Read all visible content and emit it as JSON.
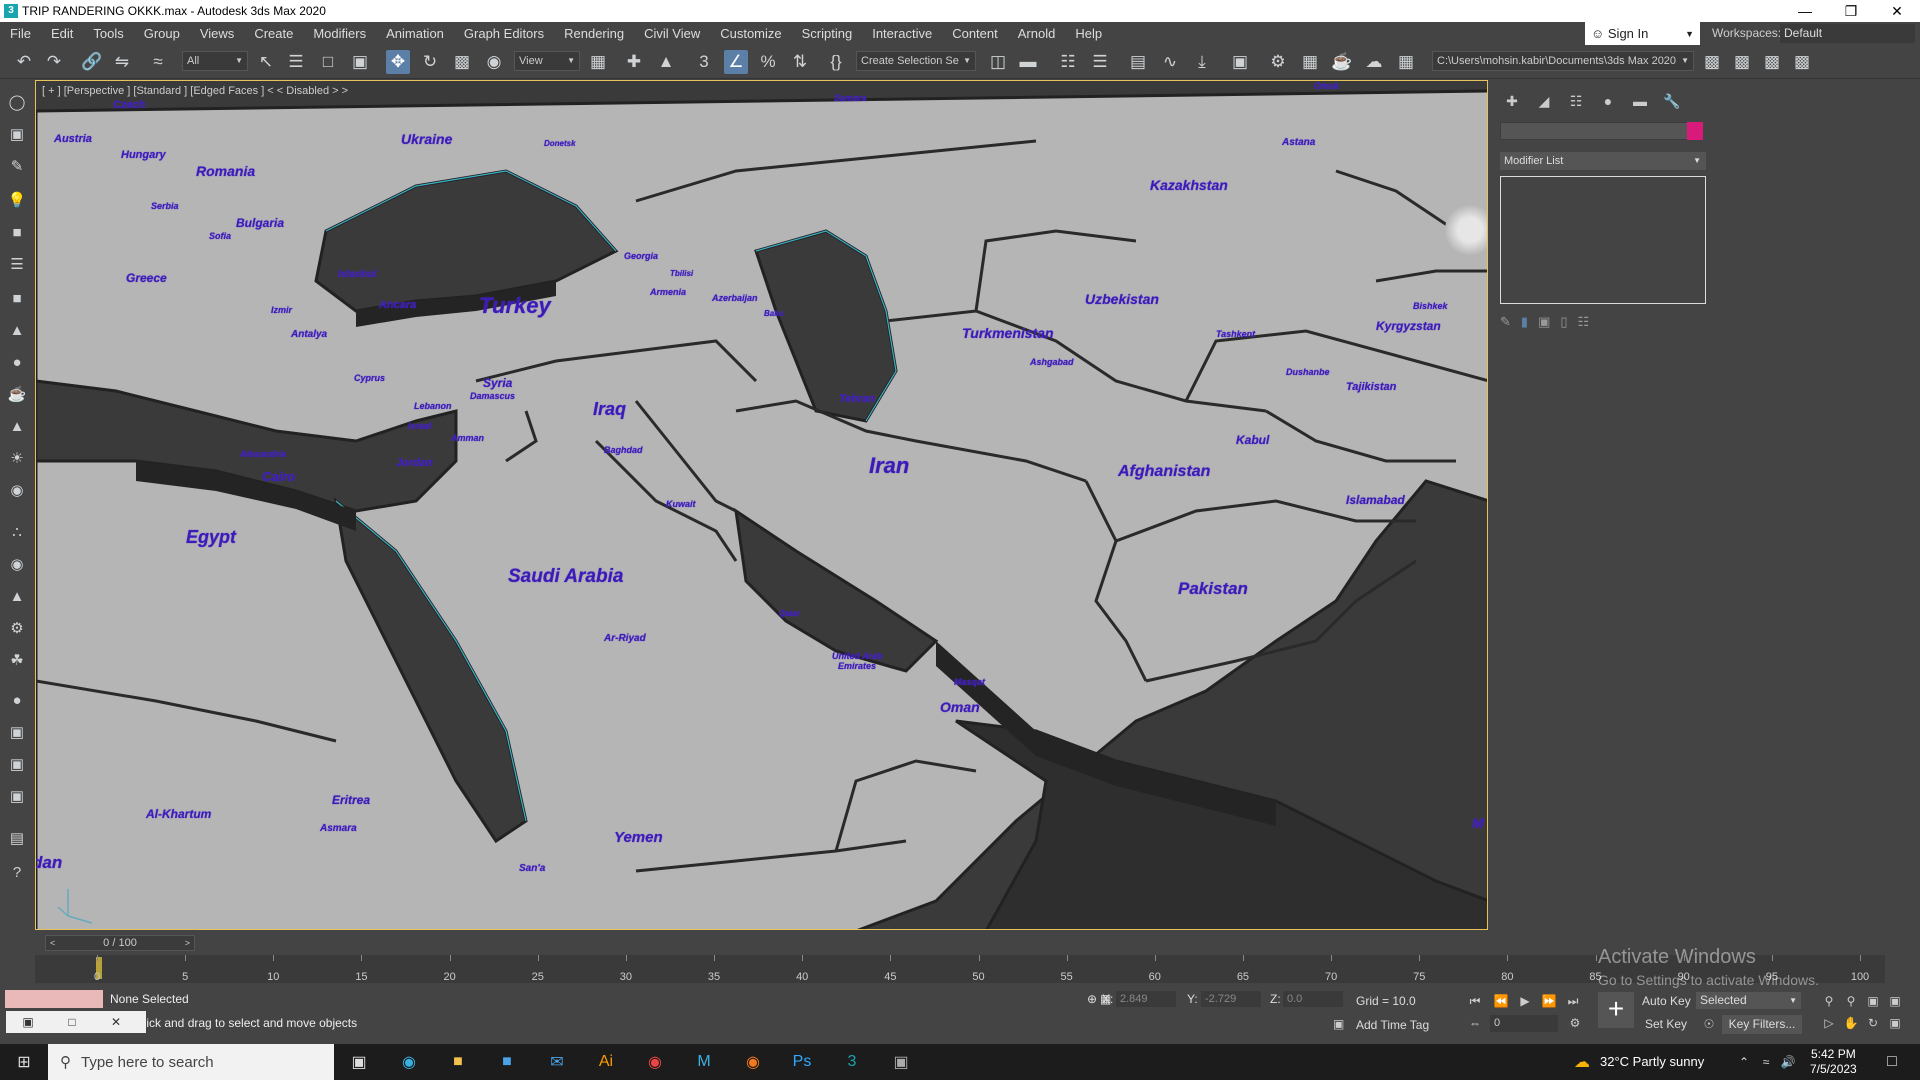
{
  "window": {
    "title": "TRIP RANDERING OKKK.max - Autodesk 3ds Max 2020",
    "app_icon": "3",
    "controls": [
      "—",
      "❐",
      "✕"
    ]
  },
  "menu": [
    "File",
    "Edit",
    "Tools",
    "Group",
    "Views",
    "Create",
    "Modifiers",
    "Animation",
    "Graph Editors",
    "Rendering",
    "Civil View",
    "Customize",
    "Scripting",
    "Interactive",
    "Content",
    "Arnold",
    "Help"
  ],
  "signin": {
    "label": "Sign In"
  },
  "workspace": {
    "label": "Workspaces:",
    "value": "Default"
  },
  "toolbar": {
    "filter_value": "All",
    "refcoord_value": "View",
    "selection_set_placeholder": "Create Selection Se",
    "path_value": "C:\\Users\\mohsin.kabir\\Documents\\3ds Max 2020"
  },
  "viewport": {
    "label": "[ + ] [Perspective ] [Standard ] [Edged Faces ]  < < Disabled > >",
    "labels": [
      {
        "t": "Czech",
        "s": 11
      },
      {
        "t": "Austria",
        "s": 11
      },
      {
        "t": "Hungary",
        "s": 11
      },
      {
        "t": "Romania",
        "s": 14
      },
      {
        "t": "Ukraine",
        "s": 14
      },
      {
        "t": "Bulgaria",
        "s": 12
      },
      {
        "t": "Serbia",
        "s": 9
      },
      {
        "t": "Sofia",
        "s": 9
      },
      {
        "t": "Greece",
        "s": 12
      },
      {
        "t": "Istanbul",
        "s": 10
      },
      {
        "t": "Izmir",
        "s": 9
      },
      {
        "t": "Ancara",
        "s": 11
      },
      {
        "t": "Antalya",
        "s": 10
      },
      {
        "t": "Turkey",
        "s": 22
      },
      {
        "t": "Cyprus",
        "s": 9
      },
      {
        "t": "Syria",
        "s": 12
      },
      {
        "t": "Damascus",
        "s": 9
      },
      {
        "t": "Lebanon",
        "s": 9
      },
      {
        "t": "Iraq",
        "s": 18
      },
      {
        "t": "Baghdad",
        "s": 9
      },
      {
        "t": "Jordan",
        "s": 11
      },
      {
        "t": "Amman",
        "s": 9
      },
      {
        "t": "Israel",
        "s": 9
      },
      {
        "t": "Alexandria",
        "s": 9
      },
      {
        "t": "Cairo",
        "s": 13
      },
      {
        "t": "Egypt",
        "s": 18
      },
      {
        "t": "Kuwait",
        "s": 9
      },
      {
        "t": "Saudi Arabia",
        "s": 19
      },
      {
        "t": "Ar-Riyad",
        "s": 10
      },
      {
        "t": "Qatar",
        "s": 8
      },
      {
        "t": "United Arab",
        "s": 9
      },
      {
        "t": "Emirates",
        "s": 9
      },
      {
        "t": "Masqat",
        "s": 9
      },
      {
        "t": "Oman",
        "s": 14
      },
      {
        "t": "Yemen",
        "s": 15
      },
      {
        "t": "San'a",
        "s": 10
      },
      {
        "t": "Eritrea",
        "s": 12
      },
      {
        "t": "Asmara",
        "s": 10
      },
      {
        "t": "Al-Khartum",
        "s": 12
      },
      {
        "t": "dan",
        "s": 17
      },
      {
        "t": "Iran",
        "s": 22
      },
      {
        "t": "Tehran",
        "s": 11
      },
      {
        "t": "Samara",
        "s": 9
      },
      {
        "t": "Donetsk",
        "s": 8
      },
      {
        "t": "Georgia",
        "s": 9
      },
      {
        "t": "Tbilisi",
        "s": 8
      },
      {
        "t": "Armenia",
        "s": 9
      },
      {
        "t": "Azerbaijan",
        "s": 9
      },
      {
        "t": "Baku",
        "s": 8
      },
      {
        "t": "Kazakhstan",
        "s": 14
      },
      {
        "t": "Astana",
        "s": 10
      },
      {
        "t": "Uzbekistan",
        "s": 14
      },
      {
        "t": "Turkmenistan",
        "s": 14
      },
      {
        "t": "Ashgabad",
        "s": 9
      },
      {
        "t": "Tashkent",
        "s": 9
      },
      {
        "t": "Kyrgyzstan",
        "s": 12
      },
      {
        "t": "Bishkek",
        "s": 9
      },
      {
        "t": "Tajikistan",
        "s": 11
      },
      {
        "t": "Dushanbe",
        "s": 9
      },
      {
        "t": "Kabul",
        "s": 12
      },
      {
        "t": "Afghanistan",
        "s": 16
      },
      {
        "t": "Islamabad",
        "s": 12
      },
      {
        "t": "Pakistan",
        "s": 17
      },
      {
        "t": "M",
        "s": 14
      },
      {
        "t": "Omsk",
        "s": 9
      }
    ]
  },
  "command_panel": {
    "modifier_list": "Modifier List",
    "color": "#d81b7a"
  },
  "timeline": {
    "slider": "0 / 100",
    "ticks": [
      "0",
      "5",
      "10",
      "15",
      "20",
      "25",
      "30",
      "35",
      "40",
      "45",
      "50",
      "55",
      "60",
      "65",
      "70",
      "75",
      "80",
      "85",
      "90",
      "95",
      "100"
    ]
  },
  "status": {
    "selection": "None Selected",
    "prompt": "Click and drag to select and move objects",
    "x_label": "X:",
    "x_value": "2.849",
    "y_label": "Y:",
    "y_value": "-2.729",
    "z_label": "Z:",
    "z_value": "0.0",
    "grid": "Grid = 10.0",
    "add_time_tag": "Add Time Tag",
    "auto_key": "Auto Key",
    "set_key": "Set Key",
    "selected": "Selected",
    "key_filters": "Key Filters...",
    "frame": "0"
  },
  "watermark": {
    "line1": "Activate Windows",
    "line2": "Go to Settings to activate Windows."
  },
  "taskbar": {
    "search": "Type here to search",
    "weather": "32°C  Partly sunny",
    "time": "5:42 PM",
    "date": "7/5/2023"
  }
}
